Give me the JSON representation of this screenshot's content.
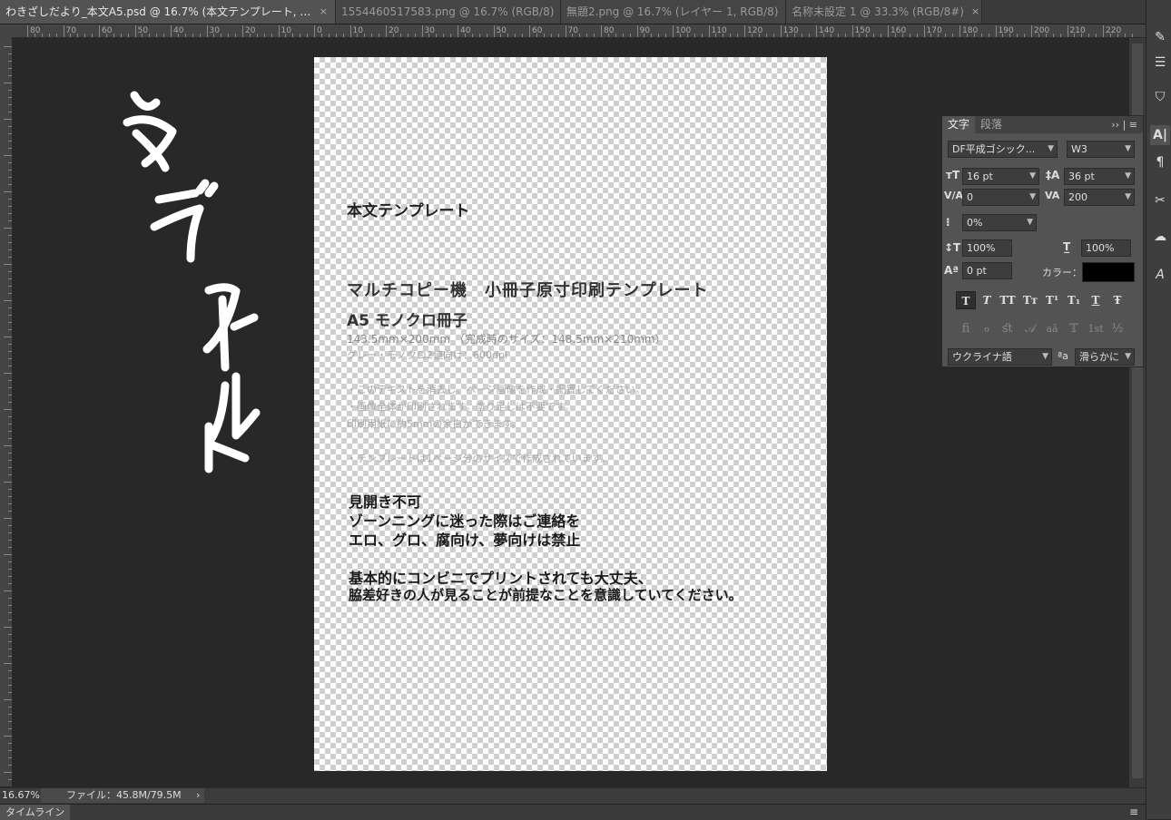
{
  "tabs": [
    {
      "label": "わきざしだより_本文A5.psd @ 16.7% (本文テンプレート, RGB/8#) *",
      "active": true
    },
    {
      "label": "1554460517583.png @ 16.7% (RGB/8)",
      "active": false
    },
    {
      "label": "無題2.png @ 16.7% (レイヤー 1, RGB/8)",
      "active": false
    },
    {
      "label": "名称未設定 1 @ 33.3% (RGB/8#)",
      "active": false
    }
  ],
  "tab_close_glyph": "×",
  "ruler": {
    "labels": [
      "80",
      "70",
      "60",
      "50",
      "40",
      "30",
      "20",
      "10",
      "0",
      "10",
      "20",
      "30",
      "40",
      "50",
      "60",
      "70",
      "80",
      "90",
      "100",
      "110",
      "120",
      "130",
      "140",
      "150",
      "160",
      "170",
      "180",
      "190",
      "200",
      "210",
      "220"
    ]
  },
  "document": {
    "title": "本文テンプレート",
    "heading": "マルチコピー機　小冊子原寸印刷テンプレート",
    "subheading": "A5 モノクロ冊子",
    "size_line": "143.5mm×200mm （完成時のサイズ：148.5mm×210mm）",
    "dpi_line": "グレー・モノクロ2値向け：600dpi",
    "notes": [
      "・このテキストを消去し、ページ画像を作成・配置してください。",
      "・画像全体が印刷されます。塗り足しは不要です。",
      "印刷用紙に約5mmの余白ができます。",
      "・テンプレートは1ページ分のサイズで作成されています。"
    ],
    "body_lines": [
      "見開き不可",
      "ゾーンニングに迷った際はご連絡を",
      "エロ、グロ、腐向け、夢向けは禁止",
      "",
      "基本的にコンビニでプリントされても大丈夫、",
      "脇差好きの人が見ることが前提なことを意識していてください。"
    ]
  },
  "char_panel": {
    "tabs": [
      "文字",
      "段落"
    ],
    "menu_glyph": "›› | ≡",
    "font_family": "DF平成ゴシック...",
    "font_weight": "W3",
    "font_size": "16 pt",
    "leading": "36 pt",
    "kerning": "0",
    "tracking": "200",
    "tsume": "0%",
    "vertical_scale": "100%",
    "horizontal_scale": "100%",
    "baseline_shift": "0 pt",
    "color_label": "カラー：",
    "text_color": "#000000",
    "style_buttons": [
      "T",
      "T",
      "TT",
      "Tт",
      "T¹",
      "T₁",
      "T",
      "Ŧ"
    ],
    "opentype_buttons": [
      "ﬁ",
      "ℴ",
      "ﬆ",
      "𝒜",
      "aā",
      "𝕋",
      "1st",
      "½"
    ],
    "language": "ウクライナ語",
    "aa_label": "ªa",
    "antialias": "滑らかに"
  },
  "status": {
    "zoom": "16.67%",
    "file_info": "ファイル：45.8M/79.5M",
    "arrow": "›"
  },
  "timeline": {
    "label": "タイムライン",
    "menu_glyph": "≡"
  }
}
